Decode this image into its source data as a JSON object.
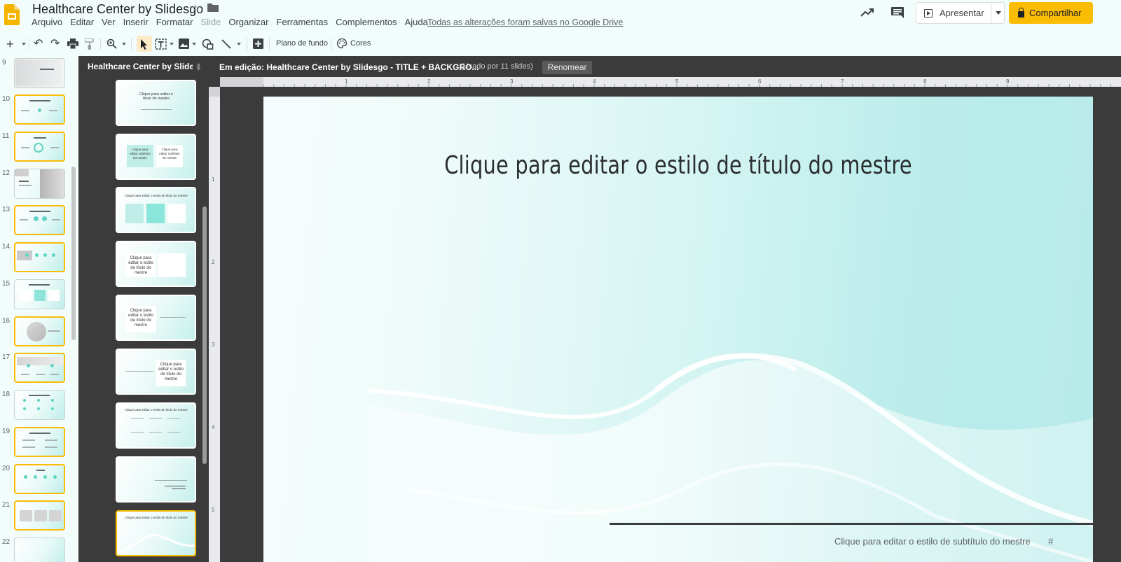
{
  "app": {
    "title": "Healthcare Center by Slidesgo",
    "menu": [
      "Arquivo",
      "Editar",
      "Ver",
      "Inserir",
      "Formatar",
      "Slide",
      "Organizar",
      "Ferramentas",
      "Complementos",
      "Ajuda"
    ],
    "saved_status": "Todas as alterações foram salvas no Google Drive",
    "present_label": "Apresentar",
    "share_label": "Compartilhar",
    "accent_color": "#fbbc04"
  },
  "toolbar": {
    "background_label": "Plano de fundo",
    "colors_label": "Cores"
  },
  "filmstrip": {
    "numbers": [
      "9",
      "10",
      "11",
      "12",
      "13",
      "14",
      "15",
      "16",
      "17",
      "18",
      "19",
      "20",
      "21",
      "22"
    ]
  },
  "layout_panel": {
    "title": "Healthcare Center by Slidesgo",
    "thumbs": [
      {
        "text": "Clique para editar o título do mestre"
      },
      {
        "text_a": "Clique para editar subtítulo do mestre",
        "text_b": "Clique para editar subtítulo do mestre"
      },
      {
        "text": "Clique para editar o estilo de título do mestre"
      },
      {
        "text": "Clique para editar o estilo de título do mestre"
      },
      {
        "text": "Clique para editar o estilo de título do mestre"
      },
      {
        "text": "Clique para editar o estilo de título do mestre"
      },
      {
        "text": "Clique para editar o estilo de título do mestre"
      },
      {
        "text": "Clique para editar o estilo de título do mestre"
      },
      {
        "text": "Clique para editar o estilo de título do mestre"
      }
    ]
  },
  "editor": {
    "header_title": "Em edição: Healthcare Center by Slidesgo - TITLE + BACKGRO...",
    "used_by": "(Usado por 11 slides)",
    "rename_label": "Renomear",
    "ruler_h": [
      "1",
      "2",
      "3",
      "4",
      "5",
      "6",
      "7",
      "8",
      "9"
    ],
    "ruler_v": [
      "1",
      "2",
      "3",
      "4",
      "5"
    ]
  },
  "slide": {
    "title": "Clique para editar o estilo de título do mestre",
    "subtitle": "Clique para editar o estilo de subtítulo do mestre",
    "number_placeholder": "#"
  }
}
